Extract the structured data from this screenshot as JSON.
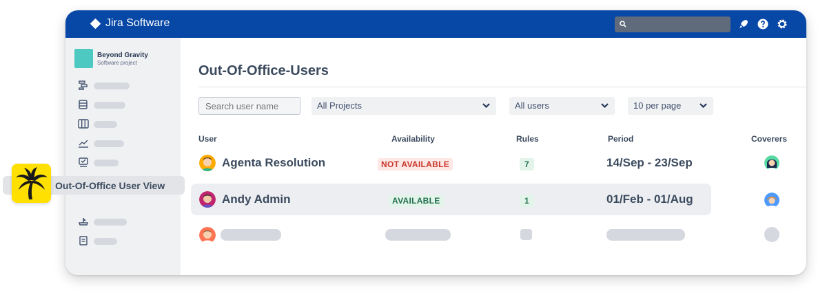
{
  "app": {
    "name": "Jira Software"
  },
  "colors": {
    "topbar": "#0747a6",
    "project_avatar": "#4ec9c1",
    "plugin_icon": "#ffe000",
    "not_available": "#c9372c",
    "available": "#216e4e"
  },
  "topbar": {
    "icons": [
      "search-icon",
      "rocket-icon",
      "help-icon",
      "settings-icon"
    ]
  },
  "sidebar": {
    "project": {
      "name": "Beyond Gravity",
      "type": "Software project"
    },
    "items": [
      "roadmap-icon",
      "backlog-icon",
      "board-icon",
      "reports-icon",
      "issues-icon",
      "out-of-office-icon",
      "releases-icon",
      "pages-icon"
    ]
  },
  "floating": {
    "label": "Out-Of-Office User View",
    "icon": "palm-tree-icon"
  },
  "main": {
    "title": "Out-Of-Office-Users",
    "filters": {
      "search_placeholder": "Search user name",
      "project": "All Projects",
      "users": "All users",
      "per_page": "10 per page"
    },
    "columns": [
      "User",
      "Availability",
      "Rules",
      "Period",
      "Coverers"
    ],
    "rows": [
      {
        "user": "Agenta Resolution",
        "availability": "NOT AVAILABLE",
        "rules": "7",
        "period": "14/Sep - 23/Sep"
      },
      {
        "user": "Andy Admin",
        "availability": "AVAILABLE",
        "rules": "1",
        "period": "01/Feb - 01/Aug"
      }
    ]
  }
}
